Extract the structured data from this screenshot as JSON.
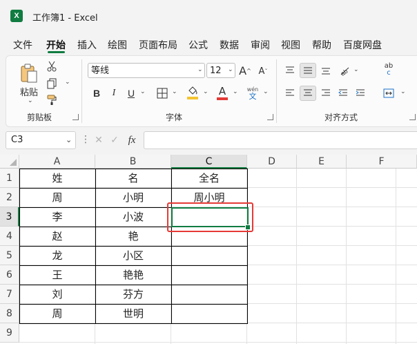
{
  "window": {
    "title": "工作簿1  -  Excel",
    "app_icon": "X"
  },
  "menu": {
    "tabs": [
      "文件",
      "开始",
      "插入",
      "绘图",
      "页面布局",
      "公式",
      "数据",
      "审阅",
      "视图",
      "帮助",
      "百度网盘"
    ],
    "active_tab": "开始"
  },
  "ribbon": {
    "clipboard": {
      "paste_label": "粘贴",
      "group_label": "剪贴板"
    },
    "font": {
      "font_name": "等线",
      "font_size": "12",
      "bold": "B",
      "italic": "I",
      "underline": "U",
      "font_color": "#e53935",
      "fill_color": "#f4c430",
      "font_color_letter": "A",
      "phonetic": "wén",
      "phonetic_char": "文",
      "grow": "A",
      "shrink": "A",
      "group_label": "字体"
    },
    "alignment": {
      "group_label": "对齐方式",
      "wrap_icon_text": "ab",
      "wrap_icon_sub": "c"
    }
  },
  "formula_bar": {
    "name_box": "C3",
    "fx_label": "fx",
    "formula": ""
  },
  "sheet": {
    "columns": [
      "A",
      "B",
      "C",
      "D",
      "E",
      "F"
    ],
    "selected_column": "C",
    "rows": [
      "1",
      "2",
      "3",
      "4",
      "5",
      "6",
      "7",
      "8",
      "9"
    ],
    "selected_row": "3",
    "cells": [
      [
        "姓",
        "名",
        "全名"
      ],
      [
        "周",
        "小明",
        "周小明"
      ],
      [
        "李",
        "小波",
        ""
      ],
      [
        "赵",
        "艳",
        ""
      ],
      [
        "龙",
        "小区",
        ""
      ],
      [
        "王",
        "艳艳",
        ""
      ],
      [
        "刘",
        "芬方",
        ""
      ],
      [
        "周",
        "世明",
        ""
      ]
    ],
    "active_cell": "C3",
    "accent_color": "#107c41",
    "highlight_color": "#e53935"
  }
}
